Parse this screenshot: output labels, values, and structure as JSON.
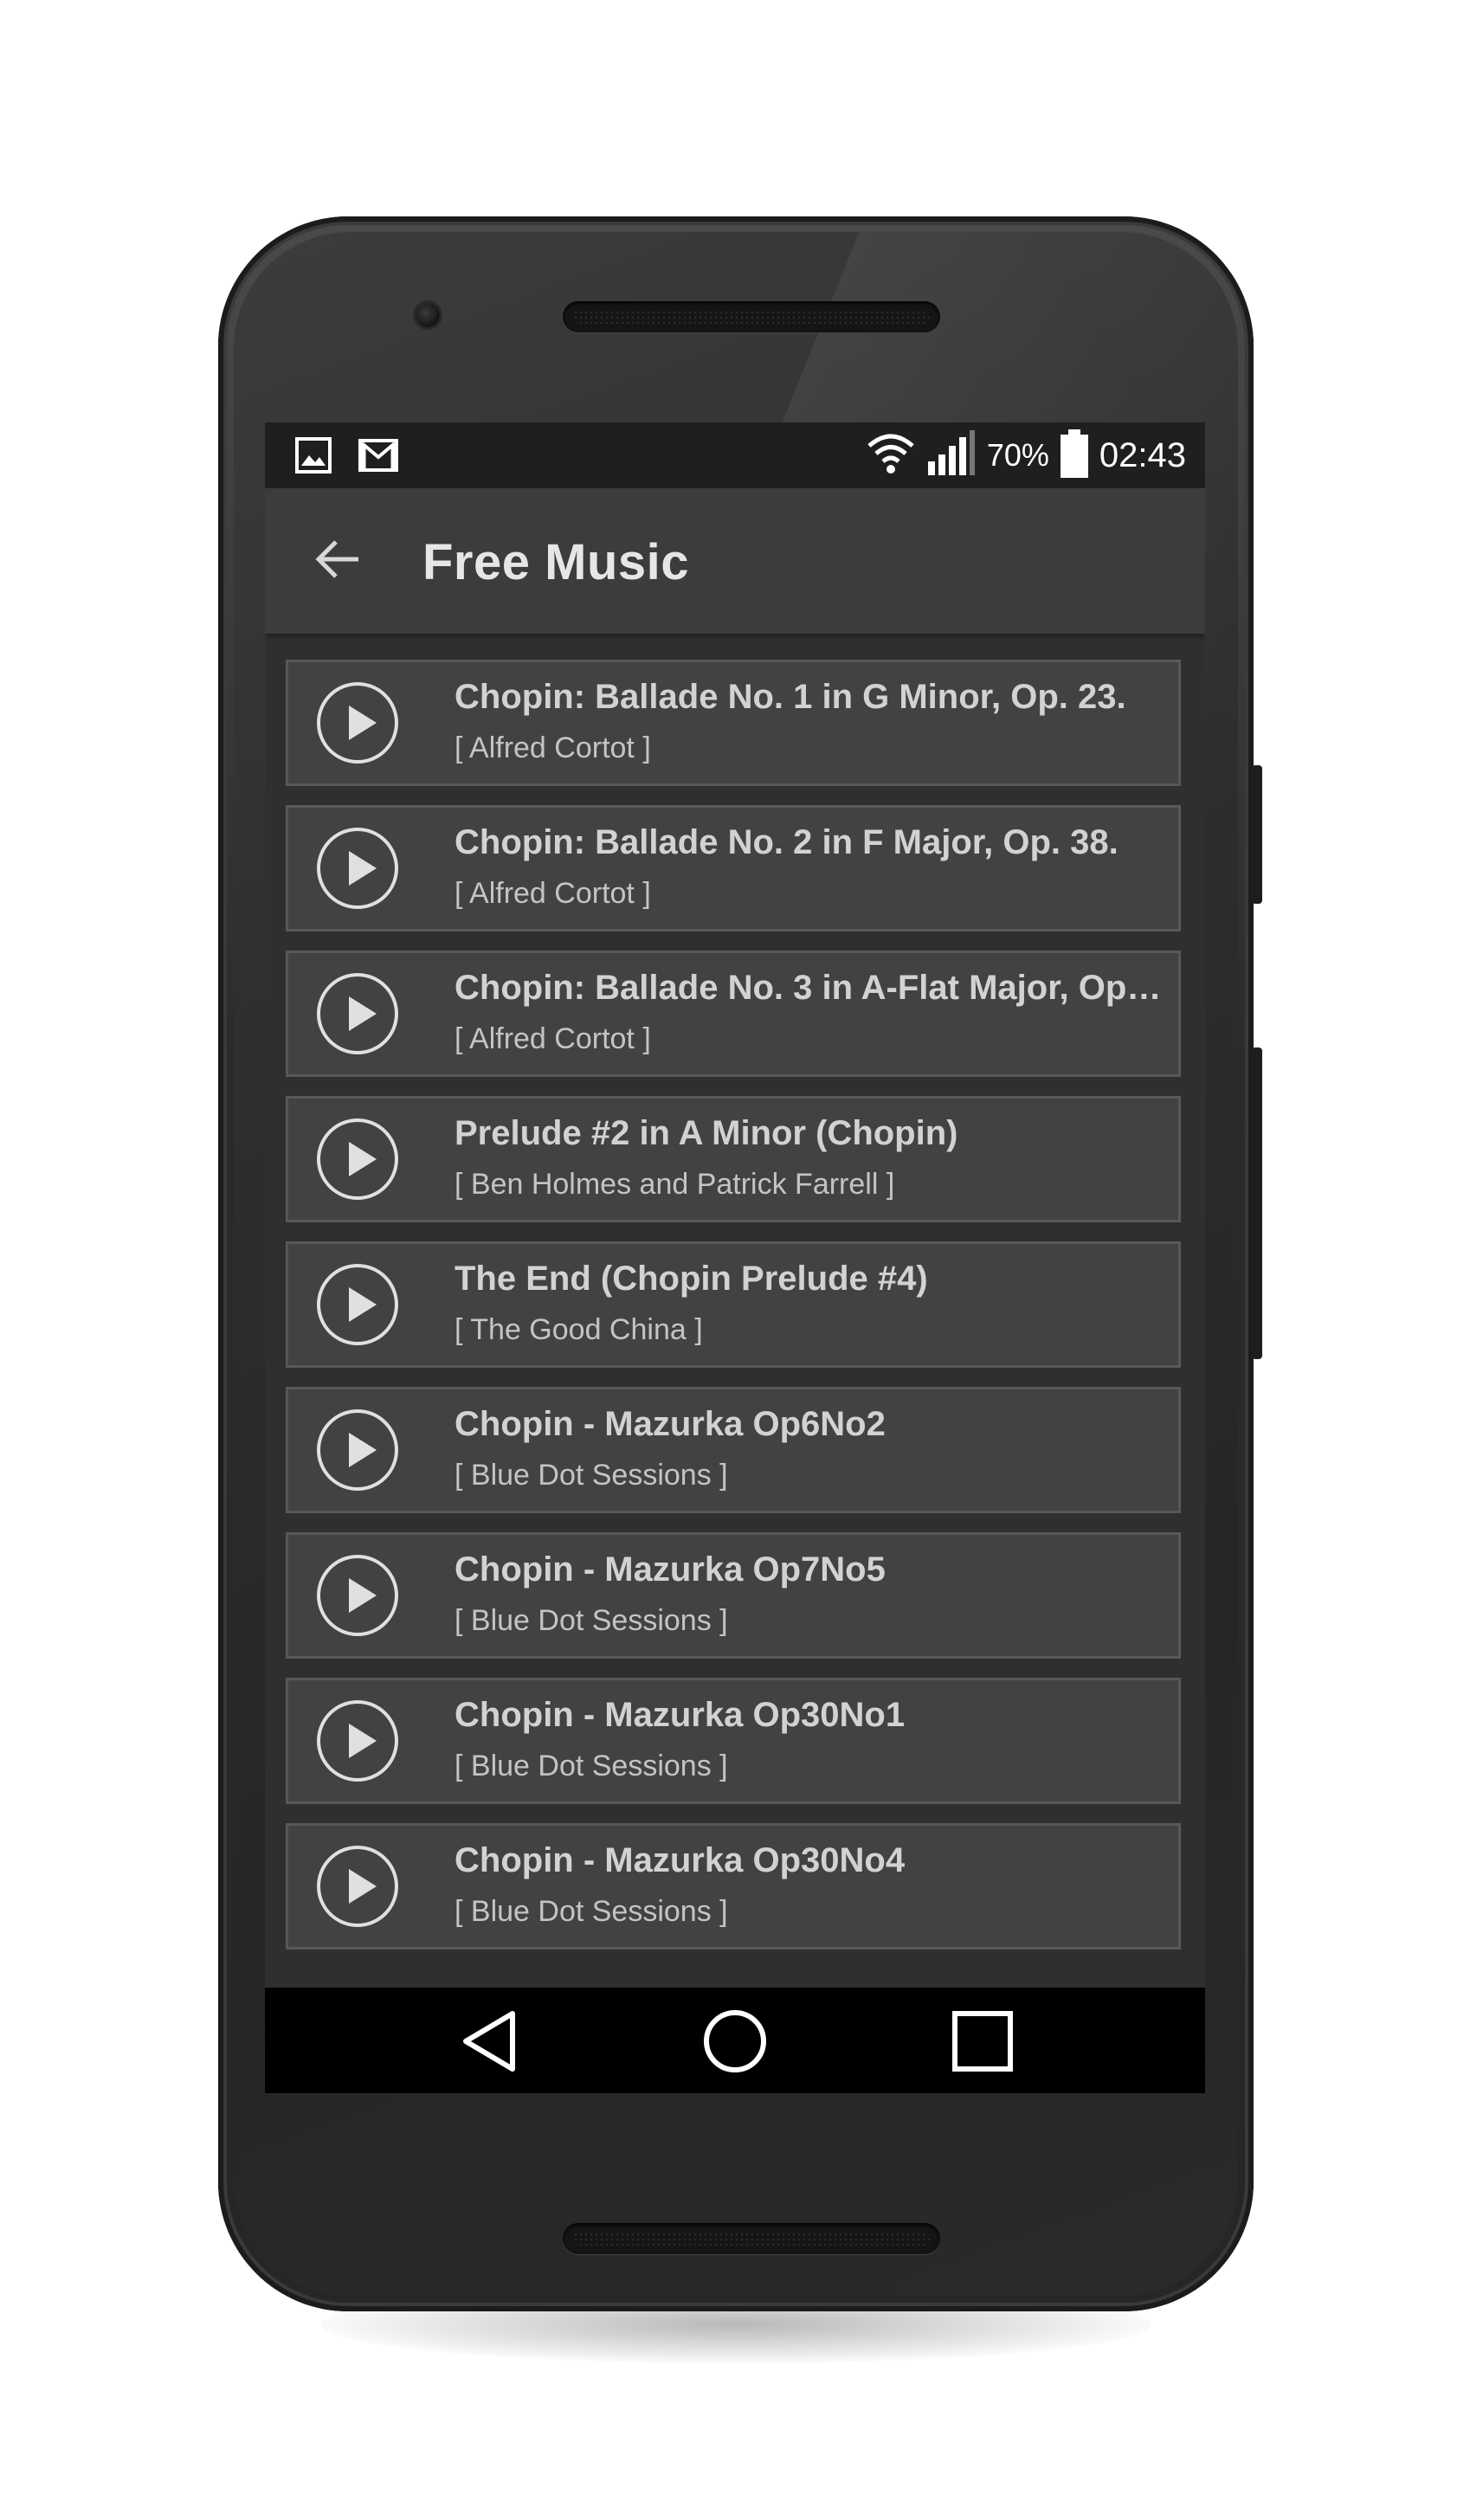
{
  "status_bar": {
    "left_icons": [
      "image-icon",
      "gmail-icon"
    ],
    "right_icons": [
      "wifi-icon",
      "cell-signal-icon",
      "battery-icon"
    ],
    "battery_percent": "70%",
    "time": "02:43"
  },
  "app_bar": {
    "back_icon": "arrow-back-icon",
    "title": "Free Music"
  },
  "tracks": [
    {
      "title": "Chopin: Ballade No. 1 in G Minor, Op. 23.",
      "artist": "[ Alfred Cortot ]"
    },
    {
      "title": "Chopin: Ballade No. 2 in F Major, Op. 38.",
      "artist": "[ Alfred Cortot ]"
    },
    {
      "title": "Chopin: Ballade No. 3 in A-Flat Major, Op.…",
      "artist": "[ Alfred Cortot ]"
    },
    {
      "title": "Prelude #2 in A Minor (Chopin)",
      "artist": "[ Ben Holmes and Patrick Farrell ]"
    },
    {
      "title": "The End (Chopin Prelude #4)",
      "artist": "[ The Good China ]"
    },
    {
      "title": "Chopin - Mazurka Op6No2",
      "artist": "[ Blue Dot Sessions ]"
    },
    {
      "title": "Chopin - Mazurka Op7No5",
      "artist": "[ Blue Dot Sessions ]"
    },
    {
      "title": "Chopin - Mazurka Op30No1",
      "artist": "[ Blue Dot Sessions ]"
    },
    {
      "title": "Chopin - Mazurka Op30No4",
      "artist": "[ Blue Dot Sessions ]"
    }
  ],
  "track_icon": "play-circle-icon",
  "nav_bar": {
    "icons": [
      "nav-back-icon",
      "nav-home-icon",
      "nav-recents-icon"
    ]
  },
  "colors": {
    "screen_bg": "#2f2f2f",
    "app_bar_bg": "#3c3c3c",
    "status_bar_bg": "#1f1f1f",
    "card_bg": "#424242",
    "card_border": "#585858",
    "title_text": "#d2d2d2",
    "artist_text": "#c4c4c4"
  }
}
